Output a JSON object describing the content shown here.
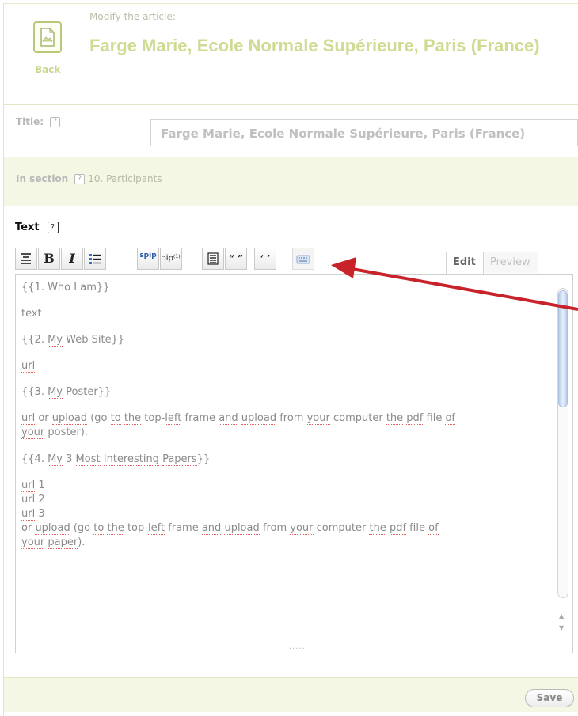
{
  "header": {
    "back_label": "Back",
    "modify_label": "Modify the article:",
    "article_title": "Farge Marie, Ecole Normale Supérieure, Paris (France)"
  },
  "title_field": {
    "label": "Title:",
    "help": "?",
    "value": "Farge Marie, Ecole Normale Supérieure, Paris (France)"
  },
  "section_field": {
    "label": "In section",
    "help": "?",
    "value": "10. Participants"
  },
  "text_field": {
    "label": "Text",
    "help": "?"
  },
  "toolbar": {
    "icons": [
      "align-center-icon",
      "bold-icon",
      "italic-icon",
      "bullet-list-icon",
      "spip-link-icon",
      "note-icon",
      "paragraph-block-icon",
      "quotes-icon",
      "single-quotes-icon",
      "keyboard-icon"
    ],
    "bold_label": "B",
    "italic_label": "I",
    "quotes_label": "“ ”",
    "single_quotes_label": "‘ ’",
    "note_label": "ɔip⁽¹⁾",
    "spip_label": "spip"
  },
  "tabs": [
    {
      "label": "Edit",
      "active": true
    },
    {
      "label": "Preview",
      "active": false
    }
  ],
  "editor": {
    "lines": [
      "{{1. Who I am}}",
      "text",
      "{{2. My Web Site}}",
      "url",
      "{{3. My Poster}}",
      "url or upload (go to the top-left frame and upload from your computer the pdf file of",
      "your poster).",
      "{{4. My 3 Most Interesting Papers}}",
      "url 1",
      "url 2",
      "url 3",
      "or upload (go to the top-left frame and upload from your computer the pdf file of",
      "your paper)."
    ]
  },
  "footer": {
    "save_label": "Save"
  },
  "colors": {
    "accent_green": "#cddc92",
    "section_bg": "#f3f7e4",
    "annotation_arrow": "#c8232b"
  }
}
